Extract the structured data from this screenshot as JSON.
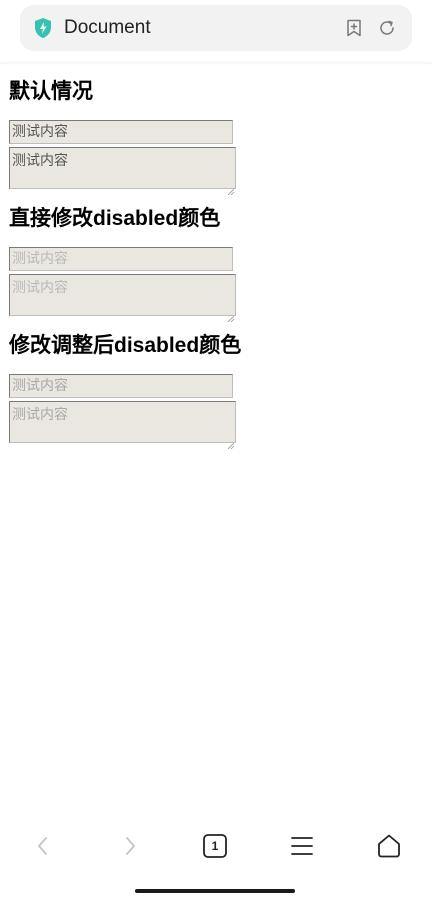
{
  "browser": {
    "tab_title": "Document",
    "shield_icon": "shield-lightning-icon",
    "bookmark_icon": "bookmark-add-icon",
    "reload_icon": "reload-icon",
    "accent": "#35c2b0"
  },
  "sections": [
    {
      "title": "默认情况",
      "input_value": "测试内容",
      "textarea_value": "测试内容"
    },
    {
      "title": "直接修改disabled颜色",
      "input_value": "测试内容",
      "textarea_value": "测试内容"
    },
    {
      "title": "修改调整后disabled颜色",
      "input_value": "测试内容",
      "textarea_value": "测试内容"
    }
  ],
  "bottom_nav": {
    "back_icon": "chevron-left-icon",
    "forward_icon": "chevron-right-icon",
    "tabs_count": "1",
    "menu_icon": "hamburger-menu-icon",
    "home_icon": "home-icon"
  }
}
